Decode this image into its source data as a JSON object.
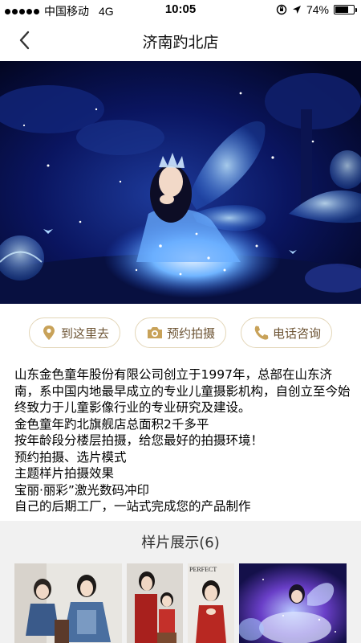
{
  "status_bar": {
    "carrier": "中国移动",
    "network": "4G",
    "time": "10:05",
    "battery": "74%",
    "battery_level": 0.74
  },
  "nav": {
    "title": "济南趵北店",
    "back_icon": "chevron-left-icon"
  },
  "hero": {
    "alt_icon": "store-banner-photo"
  },
  "actions": [
    {
      "label": "到这里去",
      "icon": "location-pin-icon"
    },
    {
      "label": "预约拍摄",
      "icon": "camera-icon"
    },
    {
      "label": "电话咨询",
      "icon": "phone-icon"
    }
  ],
  "description": [
    "山东金色童年股份有限公司创立于1997年，总部在山东济南，系中国内地最早成立的专业儿童摄影机构，自创立至今始终致力于儿童影像行业的专业研究及建设。",
    "金色童年趵北旗舰店总面积2千多平",
    "按年龄段分楼层拍摄，给您最好的拍摄环境！",
    "预约拍摄、选片模式",
    "主题样片拍摄效果",
    "宝丽·丽彩”激光数码冲印",
    "自己的后期工厂，一站式完成您的产品制作"
  ],
  "gallery": {
    "title": "样片展示(6)",
    "thumb_3_caption": "PERFECT"
  },
  "colors": {
    "accent_border": "#e3d6b8",
    "accent_text": "#6d5434",
    "icon_gold": "#c8a259",
    "gallery_bg": "#f1f1f1"
  }
}
